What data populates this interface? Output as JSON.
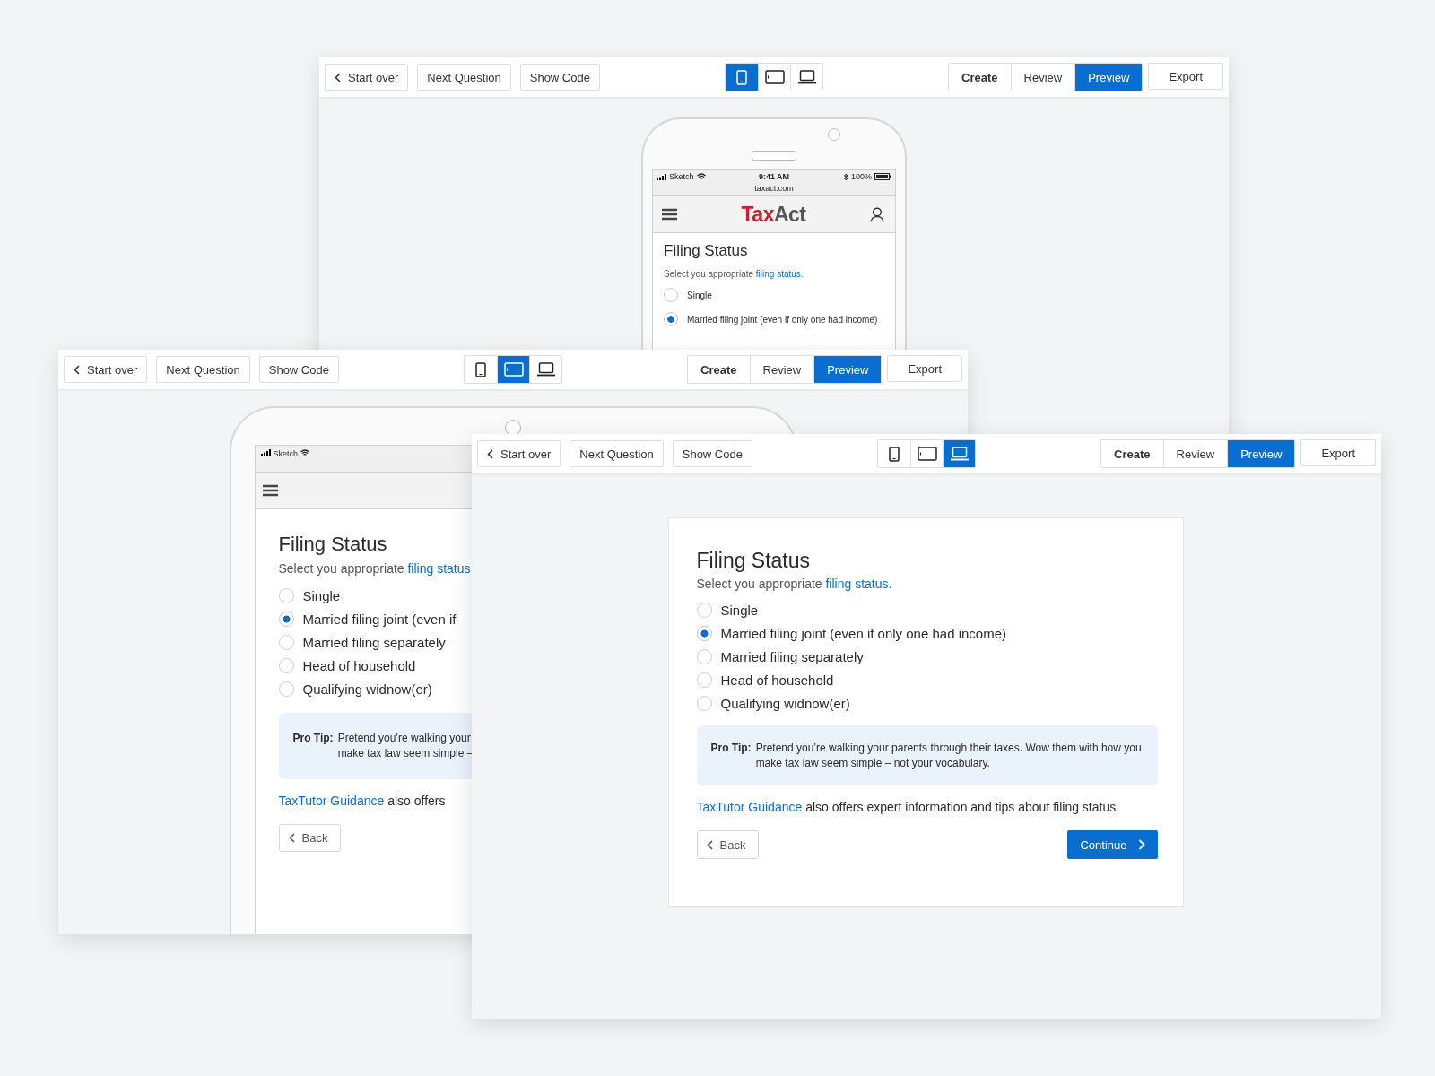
{
  "windows": [
    {
      "kind": "phone",
      "toolbar": {
        "start_over": "Start over",
        "next_question": "Next Question",
        "show_code": "Show Code",
        "devices": [
          {
            "kind": "phone",
            "selected": true
          },
          {
            "kind": "tablet",
            "selected": false
          },
          {
            "kind": "laptop",
            "selected": false
          }
        ],
        "modes": [
          {
            "label": "Create",
            "selected": false
          },
          {
            "label": "Review",
            "selected": false
          },
          {
            "label": "Preview",
            "selected": true
          }
        ],
        "export": "Export"
      },
      "status_bar": {
        "carrier": "Sketch",
        "time": "9:41 AM",
        "battery": "100%",
        "url": "taxact.com"
      },
      "logo": {
        "first": "Tax",
        "second": "Act"
      },
      "form": {
        "title": "Filing Status",
        "intro": "Select you appropriate",
        "intro_link": "filing status.",
        "options": [
          {
            "label": "Single",
            "selected": false
          },
          {
            "label": "Married filing joint (even if only one had income)",
            "selected": true
          }
        ]
      }
    },
    {
      "kind": "tablet",
      "toolbar": {
        "start_over": "Start over",
        "next_question": "Next Question",
        "show_code": "Show Code",
        "devices": [
          {
            "kind": "phone",
            "selected": false
          },
          {
            "kind": "tablet",
            "selected": true
          },
          {
            "kind": "laptop",
            "selected": false
          }
        ],
        "modes": [
          {
            "label": "Create",
            "selected": false
          },
          {
            "label": "Review",
            "selected": false
          },
          {
            "label": "Preview",
            "selected": true
          }
        ],
        "export": "Export"
      },
      "status_bar": {
        "carrier": "Sketch"
      },
      "form": {
        "title": "Filing Status",
        "intro": "Select you appropriate",
        "intro_link": "filing status",
        "options": [
          {
            "label": "Single",
            "selected": false
          },
          {
            "label": "Married filing joint (even if",
            "selected": true
          },
          {
            "label": "Married filing separately",
            "selected": false
          },
          {
            "label": "Head of household",
            "selected": false
          },
          {
            "label": "Qualifying widnow(er)",
            "selected": false
          }
        ],
        "pro_tip": {
          "label": "Pro Tip:",
          "lines": [
            "Pretend you’re walking your",
            "make tax law seem simple –"
          ]
        },
        "guidance": {
          "link": "TaxTutor Guidance",
          "text": "also offers"
        },
        "back": "Back"
      }
    },
    {
      "kind": "desktop",
      "toolbar": {
        "start_over": "Start over",
        "next_question": "Next Question",
        "show_code": "Show Code",
        "devices": [
          {
            "kind": "phone",
            "selected": false
          },
          {
            "kind": "tablet",
            "selected": false
          },
          {
            "kind": "laptop",
            "selected": true
          }
        ],
        "modes": [
          {
            "label": "Create",
            "selected": false
          },
          {
            "label": "Review",
            "selected": false
          },
          {
            "label": "Preview",
            "selected": true
          }
        ],
        "export": "Export"
      },
      "form": {
        "title": "Filing Status",
        "intro": "Select you appropriate",
        "intro_link": "filing status.",
        "options": [
          {
            "label": "Single",
            "selected": false
          },
          {
            "label": "Married filing joint (even if only one had income)",
            "selected": true
          },
          {
            "label": "Married filing separately",
            "selected": false
          },
          {
            "label": "Head of household",
            "selected": false
          },
          {
            "label": "Qualifying widnow(er)",
            "selected": false
          }
        ],
        "pro_tip": {
          "label": "Pro Tip:",
          "lines": [
            "Pretend you’re walking your parents through their taxes. Wow them with how you",
            "make tax law seem simple – not your vocabulary."
          ]
        },
        "guidance": {
          "link": "TaxTutor Guidance",
          "text": "also offers expert information and tips about filing status."
        },
        "back": "Back",
        "continue": "Continue"
      }
    }
  ]
}
